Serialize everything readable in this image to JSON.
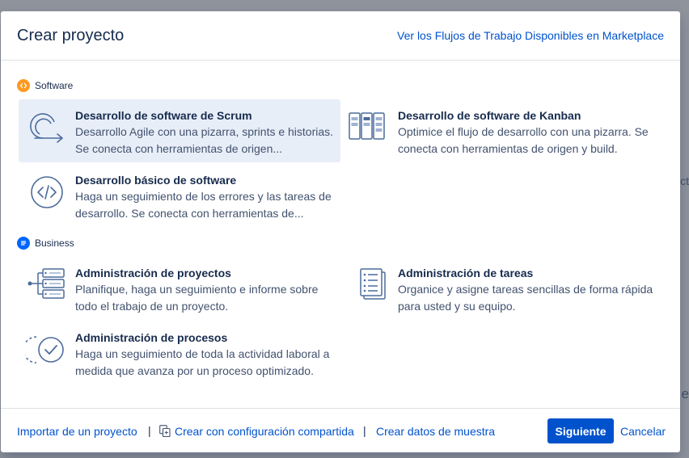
{
  "dialog": {
    "title": "Crear proyecto",
    "marketplace_link": "Ver los Flujos de Trabajo Disponibles en Marketplace"
  },
  "sections": {
    "software": {
      "label": "Software",
      "icon": "code-icon",
      "color": "#ff991f",
      "templates": [
        {
          "title": "Desarrollo de software de Scrum",
          "description": "Desarrollo Agile con una pizarra, sprints e historias. Se conecta con herramientas de origen...",
          "icon": "scrum-cycle-icon",
          "selected": true
        },
        {
          "title": "Desarrollo de software de Kanban",
          "description": "Optimice el flujo de desarrollo con una pizarra. Se conecta con herramientas de origen y build.",
          "icon": "kanban-board-icon",
          "selected": false
        },
        {
          "title": "Desarrollo básico de software",
          "description": "Haga un seguimiento de los errores y las tareas de desarrollo. Se conecta con herramientas de...",
          "icon": "code-brackets-icon",
          "selected": false
        }
      ]
    },
    "business": {
      "label": "Business",
      "icon": "document-icon",
      "color": "#0065ff",
      "templates": [
        {
          "title": "Administración de proyectos",
          "description": "Planifique, haga un seguimiento e informe sobre todo el trabajo de un proyecto.",
          "icon": "project-list-icon",
          "selected": false
        },
        {
          "title": "Administración de tareas",
          "description": "Organice y asigne tareas sencillas de forma rápida para usted y su equipo.",
          "icon": "task-list-icon",
          "selected": false
        },
        {
          "title": "Administración de procesos",
          "description": "Haga un seguimiento de toda la actividad laboral a medida que avanza por un proceso optimizado.",
          "icon": "process-check-icon",
          "selected": false
        }
      ]
    }
  },
  "footer": {
    "import_link": "Importar de un proyecto",
    "shared_config_link": "Crear con configuración compartida",
    "sample_data_link": "Crear datos de muestra",
    "next_button": "Siguiente",
    "cancel_button": "Cancelar",
    "separator": "|"
  },
  "background": {
    "partial_text_1": "ct",
    "partial_text_2": "e"
  },
  "colors": {
    "primary": "#0052cc",
    "selected_bg": "#e8eef8",
    "icon_stroke": "#4c6c9c"
  }
}
